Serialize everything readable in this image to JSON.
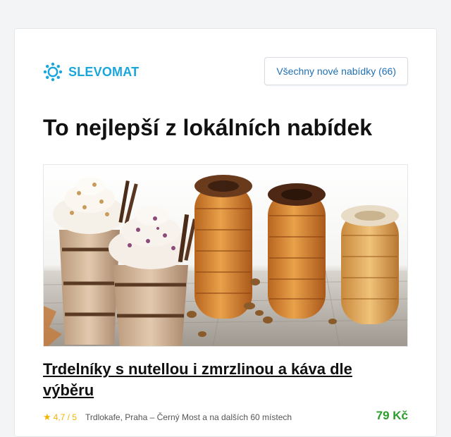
{
  "header": {
    "logo_text": "SLEVOMAT",
    "all_offers_label": "Všechny nové nabídky (66)"
  },
  "page": {
    "title": "To nejlepší z lokálních nabídek"
  },
  "offer": {
    "title": "Trdelníky s nutellou i zmrzlinou a káva dle výběru",
    "rating": "4,7 / 5",
    "location": "Trdlokafe, Praha – Černý Most a na dalších 60 místech",
    "price": "79 Kč",
    "image_icon": "trdelnik-and-coffee-image"
  },
  "colors": {
    "brand": "#1aa6dc",
    "link": "#1f6fb2",
    "price": "#2a9d2a",
    "star": "#f4b400"
  }
}
